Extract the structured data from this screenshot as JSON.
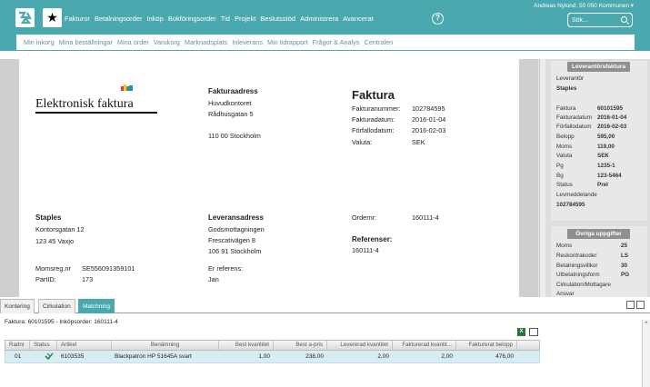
{
  "header": {
    "user": "Andreas Nylund, 50 050 Kommunen ▾",
    "nav": [
      "Fakturor",
      "Betalningsorder",
      "Inköp",
      "Bokföringsorder",
      "Tid",
      "Projekt",
      "Beslutsstöd",
      "Administrera",
      "Avancerat"
    ],
    "help": "?",
    "search_placeholder": "Sök..."
  },
  "subnav": [
    "Min inkorg",
    "Mina beställningar",
    "Mina order",
    "Varukorg",
    "Marknadsplats",
    "Inleverans",
    "Min tidrapport",
    "Frågor & Analys",
    "Centralen"
  ],
  "invoice": {
    "logo_text": "Elektronisk faktura",
    "billing_address_title": "Fakturaadress",
    "billing_address": [
      "Huvudkontoret",
      "Rådhusgatan 5",
      "",
      "110 00 Stockholm"
    ],
    "title": "Faktura",
    "meta_labels": [
      "Fakturanummer:",
      "Fakturadatum:",
      "Förfallodatum:",
      "Valuta:"
    ],
    "meta_values": [
      "102784595",
      "2016-01-04",
      "2016-02-03",
      "SEK"
    ],
    "supplier_name": "Staples",
    "supplier_address": [
      "Kontorsgatan 12",
      "123 45 Vaxjo"
    ],
    "delivery_title": "Leveransadress",
    "delivery_address": [
      "Godsmottagningen",
      "Frescativägen 8",
      "106 91 Stockholm"
    ],
    "order_label": "Ordernr:",
    "order_value": "160111-4",
    "ref_title": "Referenser:",
    "ref_value": "160111-4",
    "vat_label": "Momsreg.nr",
    "vat_value": "SE556091359101",
    "part_label": "PartID:",
    "part_value": "173",
    "our_ref_label": "Er referens:",
    "our_ref_value": "Jan"
  },
  "right_panel": {
    "supplier_head": "Leverantörsfaktura",
    "supplier_label": "Leverantör",
    "supplier_value": "Staples",
    "fields": [
      {
        "label": "Faktura",
        "value": "60101595"
      },
      {
        "label": "Fakturadatum",
        "value": "2016-01-04"
      },
      {
        "label": "Förfallodatum",
        "value": "2016-02-03"
      },
      {
        "label": "Belopp",
        "value": "595,00"
      },
      {
        "label": "Moms",
        "value": "119,00"
      },
      {
        "label": "Valuta",
        "value": "SEK"
      },
      {
        "label": "Pg",
        "value": "1235-1"
      },
      {
        "label": "Bg",
        "value": "123-5464"
      },
      {
        "label": "Status",
        "value": "Prel"
      }
    ],
    "message_label": "Levmeddelande",
    "message_value": "102784595",
    "other_head": "Övriga uppgifter",
    "other_fields": [
      {
        "label": "Moms",
        "value": "25"
      },
      {
        "label": "Reskontrakoder",
        "value": "LS"
      },
      {
        "label": "Betalningsvillkor",
        "value": "30"
      },
      {
        "label": "Utbetalningsform",
        "value": "PG"
      }
    ],
    "other_extra": [
      "Cirkulation/Mottagare",
      "Ansvar"
    ]
  },
  "tabs": [
    "Kontering",
    "Cirkulation",
    "Matchning"
  ],
  "lower": {
    "title": "Faktura: 60101595 - Inköpsorder: 160111-4",
    "columns": [
      "Radnr",
      "Status",
      "Artikel",
      "Benämning",
      "Best kvantitet",
      "Best a-pris",
      "Levererad kvantitet",
      "Fakturerad kvantit...",
      "Fakturerat belopp"
    ],
    "rows": [
      [
        "01",
        "",
        "6103535",
        "Blackpatron HP 51645A svart",
        "1,00",
        "238,00",
        "2,00",
        "2,00",
        "476,00"
      ]
    ]
  }
}
